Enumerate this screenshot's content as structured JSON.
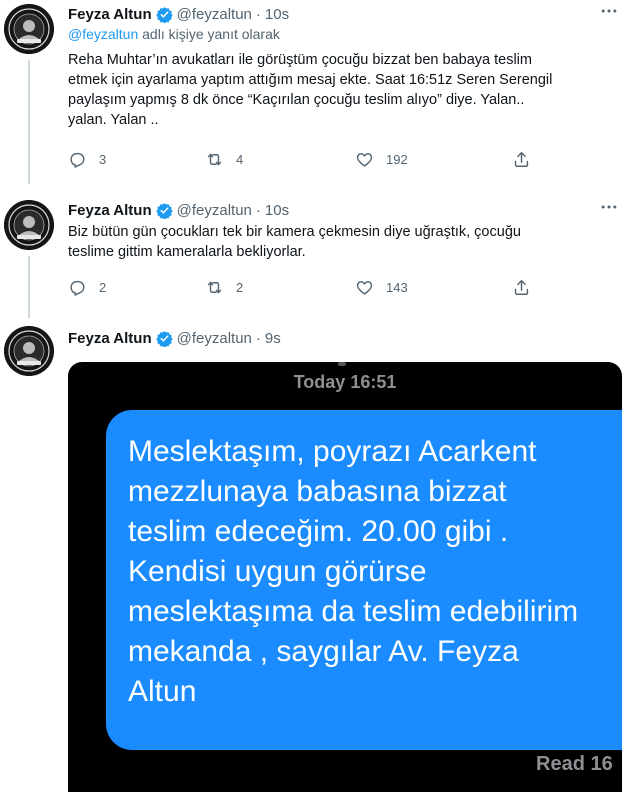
{
  "tweets": [
    {
      "author": "Feyza Altun",
      "handle": "@feyzaltun",
      "separator": "·",
      "time": "10s",
      "reply_prefix": "@feyzaltun",
      "reply_suffix": " adlı kişiye yanıt olarak",
      "lines": [
        "Reha Muhtar’ın avukatları ile görüştüm çocuğu bizzat ben babaya teslim",
        "etmek için ayarlama yaptım attığım mesaj ekte. Saat 16:51z Seren Serengil",
        "paylaşım yapmış  8 dk önce “Kaçırılan çocuğu teslim alıyo” diye. Yalan..",
        "yalan. Yalan .."
      ],
      "replies": "3",
      "retweets": "4",
      "likes": "192"
    },
    {
      "author": "Feyza Altun",
      "handle": "@feyzaltun",
      "separator": "·",
      "time": "10s",
      "lines": [
        "Biz bütün gün çocukları tek bir kamera çekmesin diye uğraştık, çocuğu",
        "teslime gittim kameralarla bekliyorlar."
      ],
      "replies": "2",
      "retweets": "2",
      "likes": "143"
    },
    {
      "author": "Feyza Altun",
      "handle": "@feyzaltun",
      "separator": "·",
      "time": "9s"
    }
  ],
  "media": {
    "header": "Today 16:51",
    "message_lines": [
      "Meslektaşım, poyrazı Acarkent",
      "mezzlunaya babasına bizzat",
      "teslim edeceğim. 20.00 gibi .",
      "Kendisi uygun görürse",
      "meslektaşıma da teslim edebilirim",
      "mekanda , saygılar Av. Feyza",
      "Altun"
    ],
    "read_label": "Read 16"
  },
  "colors": {
    "accent": "#1d9bf0",
    "bubble": "#1a8cff",
    "secondary_text": "#536471"
  },
  "icons": {
    "verified": "verified-badge-icon",
    "more": "more-dots-icon",
    "reply": "reply-icon",
    "retweet": "retweet-icon",
    "like": "heart-icon",
    "share": "share-icon"
  }
}
